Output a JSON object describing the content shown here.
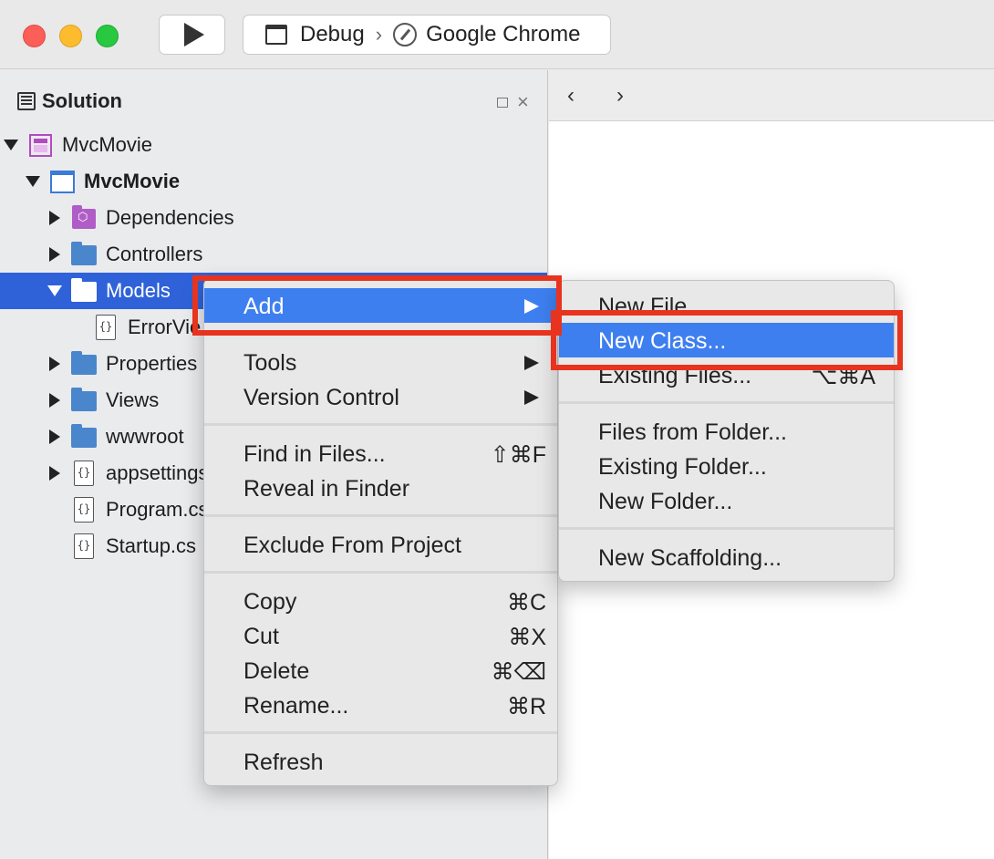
{
  "toolbar": {
    "config_label": "Debug",
    "config_separator": "›",
    "target_label": "Google Chrome"
  },
  "solution_pad": {
    "title": "Solution",
    "close_glyph": "×",
    "items": [
      {
        "label": "MvcMovie",
        "icon": "solution-icon"
      },
      {
        "label": "MvcMovie",
        "icon": "project-icon"
      },
      {
        "label": "Dependencies",
        "icon": "dependencies-folder-icon"
      },
      {
        "label": "Controllers",
        "icon": "folder-icon"
      },
      {
        "label": "Models",
        "icon": "folder-icon"
      },
      {
        "label": "ErrorVie",
        "icon": "cs-file-icon"
      },
      {
        "label": "Properties",
        "icon": "folder-icon"
      },
      {
        "label": "Views",
        "icon": "folder-icon"
      },
      {
        "label": "wwwroot",
        "icon": "folder-icon"
      },
      {
        "label": "appsettings",
        "icon": "json-file-icon"
      },
      {
        "label": "Program.cs",
        "icon": "cs-file-icon"
      },
      {
        "label": "Startup.cs",
        "icon": "cs-file-icon"
      }
    ],
    "file_glyph": "{}"
  },
  "browser": {
    "back_glyph": "‹",
    "forward_glyph": "›"
  },
  "context_menu": {
    "add": "Add",
    "tools": "Tools",
    "version_control": "Version Control",
    "find_in_files": "Find in Files...",
    "find_in_files_shortcut": "⇧⌘F",
    "reveal_in_finder": "Reveal in Finder",
    "exclude_from_project": "Exclude From Project",
    "copy": "Copy",
    "copy_shortcut": "⌘C",
    "cut": "Cut",
    "cut_shortcut": "⌘X",
    "delete": "Delete",
    "delete_shortcut": "⌘⌫",
    "rename": "Rename...",
    "rename_shortcut": "⌘R",
    "refresh": "Refresh"
  },
  "add_submenu": {
    "new_file": "New File...",
    "new_class": "New Class...",
    "existing_files": "Existing Files...",
    "existing_files_shortcut": "⌥⌘A",
    "files_from_folder": "Files from Folder...",
    "existing_folder": "Existing Folder...",
    "new_folder": "New Folder...",
    "new_scaffolding": "New Scaffolding..."
  },
  "colors": {
    "selection": "#2f62d9",
    "menu_highlight": "#3e7ff0",
    "annotation_red": "#e8331e",
    "folder_blue": "#4a86cc"
  }
}
